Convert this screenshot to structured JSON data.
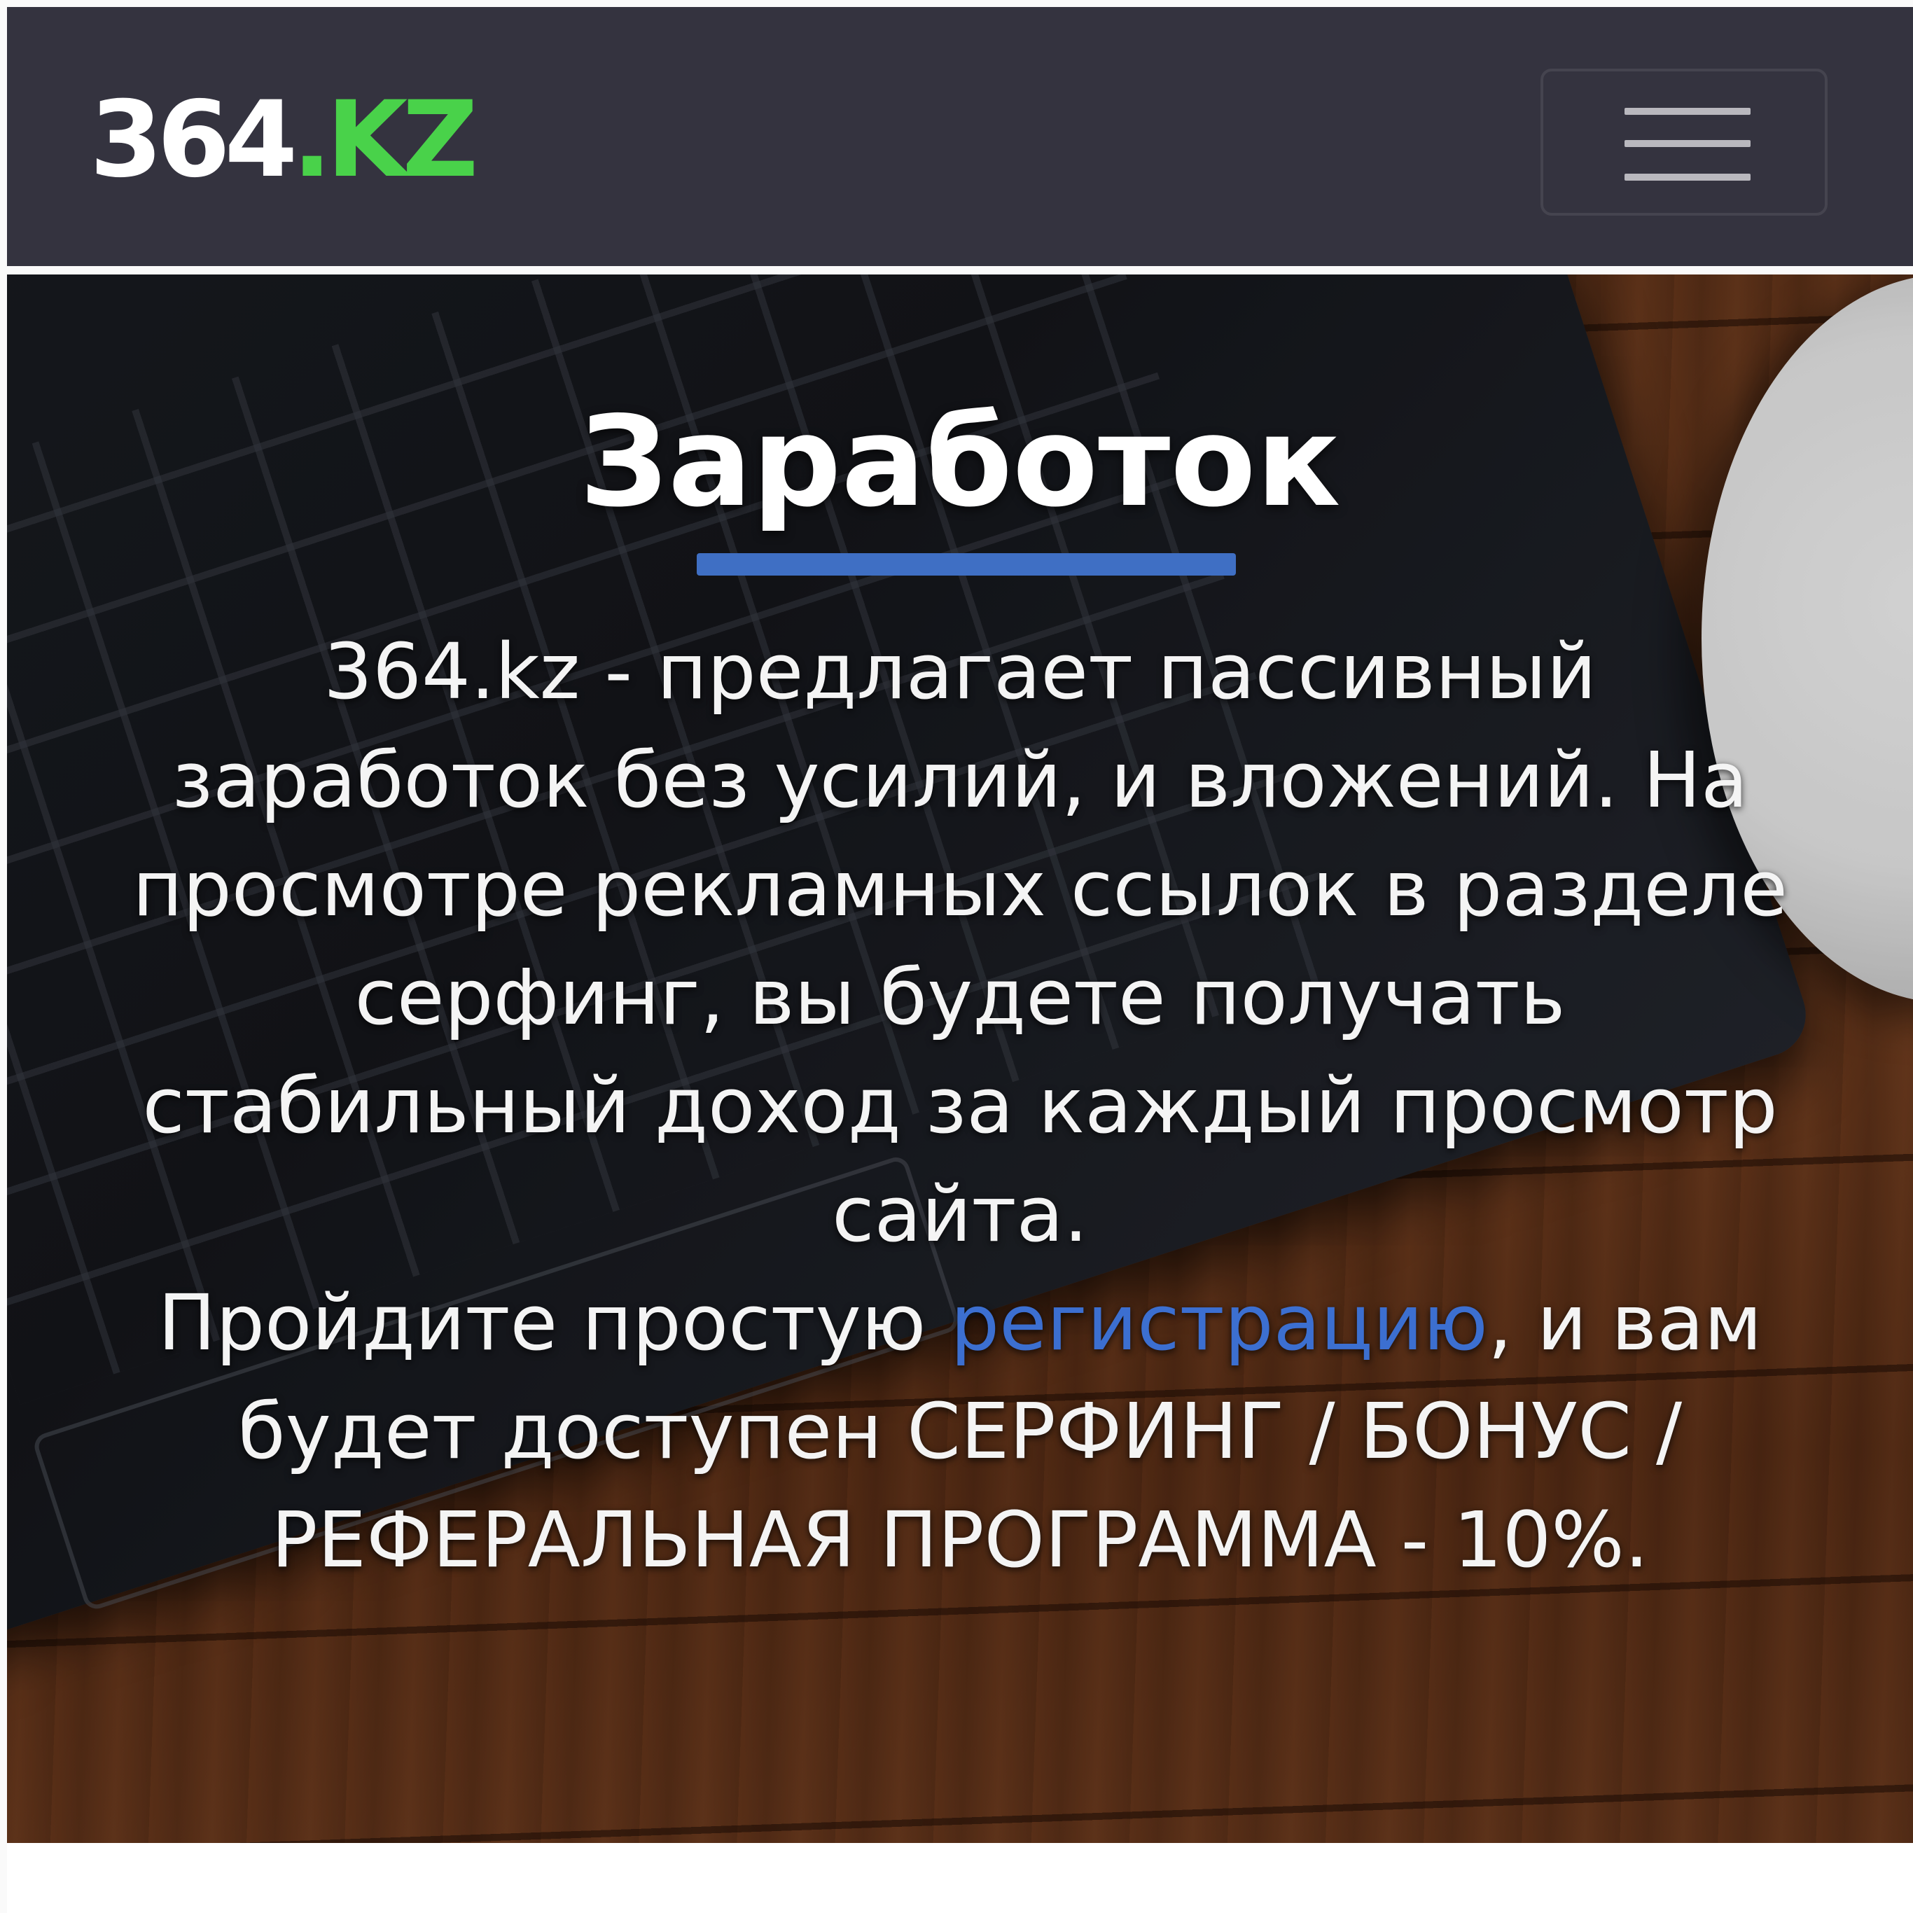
{
  "brand": {
    "logo_number": "364",
    "logo_domain": ".KZ",
    "logo_number_color": "#ffffff",
    "logo_domain_color": "#49d24a"
  },
  "navbar": {
    "background": "#34333f",
    "menu_icon": "hamburger-menu-icon"
  },
  "hero": {
    "title": "Заработок",
    "divider_color": "#3f6fc4",
    "paragraph1": "364.kz - предлагает пассивный заработок без усилий, и вложений. На просмотре рекламных ссылок в разделе серфинг, вы будете получать стабильный доход за каждый просмотр сайта.",
    "paragraph2_before": "Пройдите простую ",
    "registration_link": "регистрацию",
    "paragraph2_after": ", и вам будет доступен СЕРФИНГ / БОНУС / РЕФЕРАЛЬНАЯ ПРОГРАММА - 10%.",
    "link_color": "#3c6fd0"
  }
}
